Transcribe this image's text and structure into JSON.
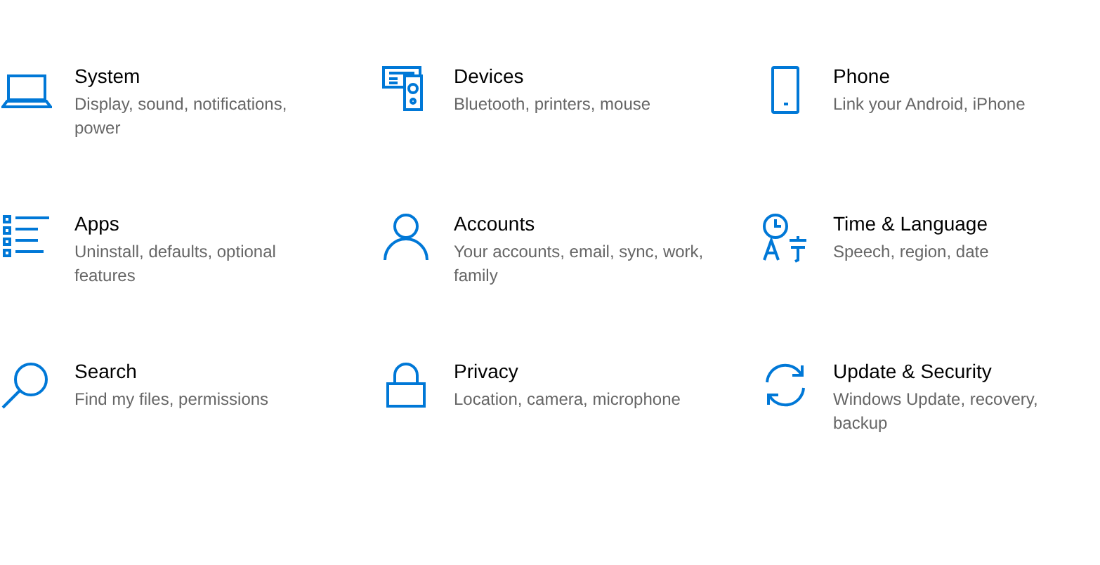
{
  "categories": [
    {
      "kind": "system",
      "title": "System",
      "description": "Display, sound, notifications, power"
    },
    {
      "kind": "devices",
      "title": "Devices",
      "description": "Bluetooth, printers, mouse"
    },
    {
      "kind": "phone",
      "title": "Phone",
      "description": "Link your Android, iPhone"
    },
    {
      "kind": "apps",
      "title": "Apps",
      "description": "Uninstall, defaults, optional features"
    },
    {
      "kind": "accounts",
      "title": "Accounts",
      "description": "Your accounts, email, sync, work, family"
    },
    {
      "kind": "time",
      "title": "Time & Language",
      "description": "Speech, region, date"
    },
    {
      "kind": "search",
      "title": "Search",
      "description": "Find my files, permissions"
    },
    {
      "kind": "privacy",
      "title": "Privacy",
      "description": "Location, camera, microphone"
    },
    {
      "kind": "update",
      "title": "Update & Security",
      "description": "Windows Update, recovery, backup"
    }
  ]
}
